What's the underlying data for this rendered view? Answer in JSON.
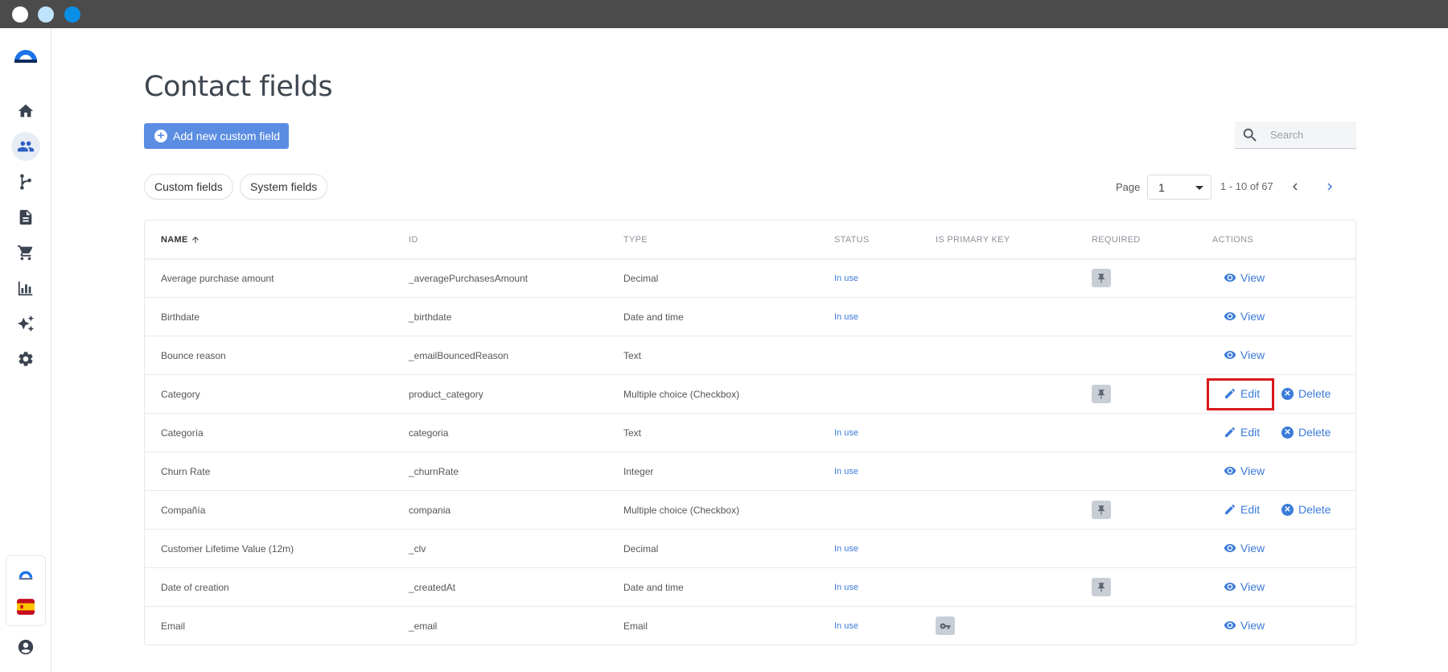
{
  "window": {
    "dots": [
      "close",
      "minimize",
      "maximize"
    ]
  },
  "sidebar": {
    "items": [
      {
        "name": "logo",
        "icon": "brand-logo-icon"
      },
      {
        "name": "home",
        "icon": "home-icon"
      },
      {
        "name": "contacts",
        "icon": "people-icon",
        "active": true
      },
      {
        "name": "automation",
        "icon": "branch-icon"
      },
      {
        "name": "content",
        "icon": "document-icon"
      },
      {
        "name": "ecommerce",
        "icon": "cart-icon"
      },
      {
        "name": "reports",
        "icon": "bar-chart-icon"
      },
      {
        "name": "ai",
        "icon": "sparkle-icon"
      },
      {
        "name": "settings",
        "icon": "gear-icon"
      }
    ],
    "bottom": [
      {
        "name": "account-logo",
        "icon": "brand-mini-logo-icon"
      },
      {
        "name": "language",
        "icon": "spain-flag-icon"
      },
      {
        "name": "profile",
        "icon": "user-circle-icon"
      }
    ]
  },
  "page": {
    "title": "Contact fields",
    "add_button": "Add new custom field",
    "search_placeholder": "Search",
    "tabs": [
      "Custom fields",
      "System fields"
    ],
    "pagination": {
      "label": "Page",
      "current": "1",
      "range": "1 - 10 of 67"
    }
  },
  "table": {
    "headers": [
      "NAME",
      "ID",
      "TYPE",
      "STATUS",
      "IS PRIMARY KEY",
      "REQUIRED",
      "ACTIONS"
    ],
    "rows": [
      {
        "name": "Average purchase amount",
        "id": "_averagePurchasesAmount",
        "type": "Decimal",
        "status": "In use",
        "primary_key": false,
        "required": true,
        "actions": [
          "View"
        ]
      },
      {
        "name": "Birthdate",
        "id": "_birthdate",
        "type": "Date and time",
        "status": "In use",
        "primary_key": false,
        "required": false,
        "actions": [
          "View"
        ]
      },
      {
        "name": "Bounce reason",
        "id": "_emailBouncedReason",
        "type": "Text",
        "status": "",
        "primary_key": false,
        "required": false,
        "actions": [
          "View"
        ]
      },
      {
        "name": "Category",
        "id": "product_category",
        "type": "Multiple choice (Checkbox)",
        "status": "",
        "primary_key": false,
        "required": true,
        "actions": [
          "Edit",
          "Delete"
        ],
        "highlighted": true
      },
      {
        "name": "Categoría",
        "id": "categoria",
        "type": "Text",
        "status": "In use",
        "primary_key": false,
        "required": false,
        "actions": [
          "Edit",
          "Delete"
        ]
      },
      {
        "name": "Churn Rate",
        "id": "_churnRate",
        "type": "Integer",
        "status": "In use",
        "primary_key": false,
        "required": false,
        "actions": [
          "View"
        ]
      },
      {
        "name": "Compañía",
        "id": "compania",
        "type": "Multiple choice (Checkbox)",
        "status": "",
        "primary_key": false,
        "required": true,
        "actions": [
          "Edit",
          "Delete"
        ]
      },
      {
        "name": "Customer Lifetime Value (12m)",
        "id": "_clv",
        "type": "Decimal",
        "status": "In use",
        "primary_key": false,
        "required": false,
        "actions": [
          "View"
        ]
      },
      {
        "name": "Date of creation",
        "id": "_createdAt",
        "type": "Date and time",
        "status": "In use",
        "primary_key": false,
        "required": true,
        "actions": [
          "View"
        ]
      },
      {
        "name": "Email",
        "id": "_email",
        "type": "Email",
        "status": "In use",
        "primary_key": true,
        "required": false,
        "actions": [
          "View"
        ]
      }
    ]
  },
  "colors": {
    "accent": "#3b7bd8",
    "button": "#5b8de2",
    "highlight": "#d9191c",
    "titlebar": "#4b4b4b"
  }
}
